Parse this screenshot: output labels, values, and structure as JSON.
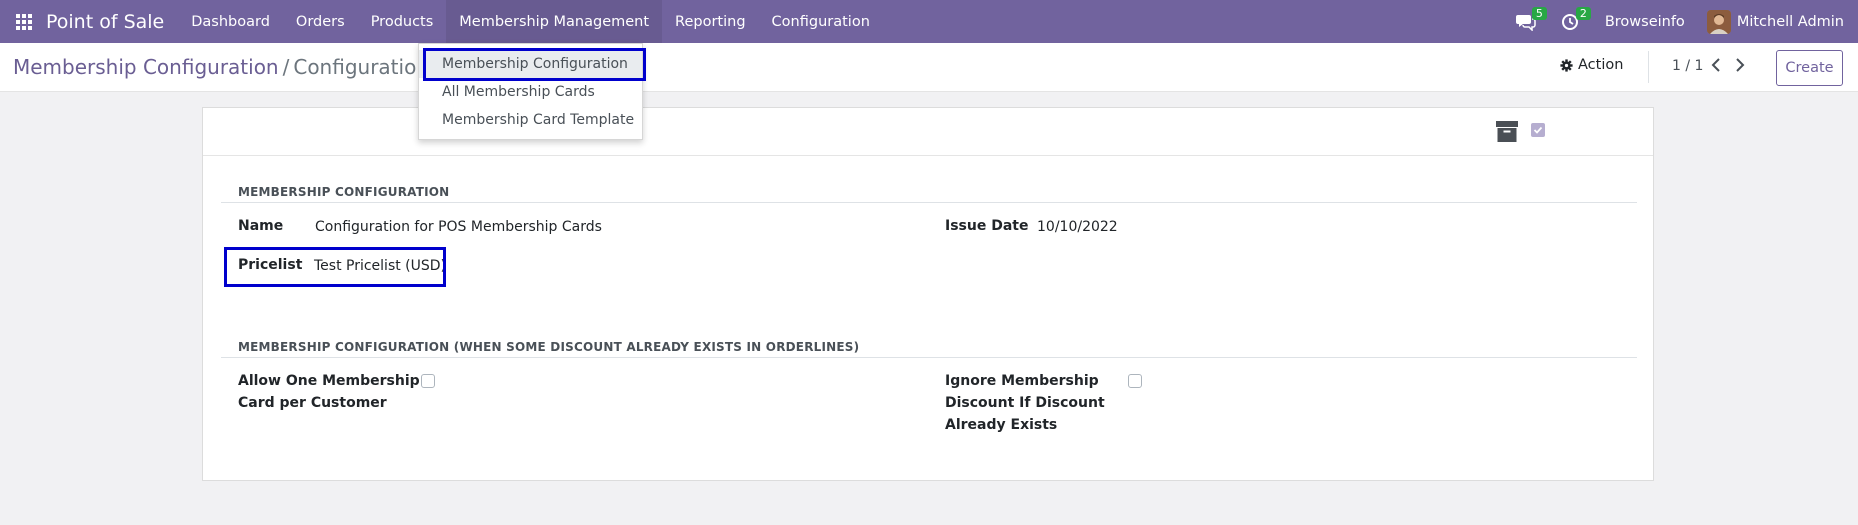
{
  "navbar": {
    "brand": "Point of Sale",
    "menu": [
      "Dashboard",
      "Orders",
      "Products",
      "Membership Management",
      "Reporting",
      "Configuration"
    ],
    "messages_count": "5",
    "activities_count": "2",
    "company": "Browseinfo",
    "user": "Mitchell Admin",
    "colors": {
      "bar": "#71639e",
      "badge": "#28a745"
    }
  },
  "dropdown": {
    "items": [
      "Membership Configuration",
      "All Membership Cards",
      "Membership Card Template"
    ]
  },
  "control_panel": {
    "breadcrumb_parent": "Membership Configuration",
    "breadcrumb_current": "Configuration fo",
    "action_label": "Action",
    "pager": "1 / 1",
    "create_label": "Create"
  },
  "form": {
    "section1_title": "MEMBERSHIP CONFIGURATION",
    "name_label": "Name",
    "name_value": "Configuration for POS Membership Cards",
    "issue_date_label": "Issue Date",
    "issue_date_value": "10/10/2022",
    "pricelist_label": "Pricelist",
    "pricelist_value": "Test Pricelist (USD)",
    "section2_title": "MEMBERSHIP CONFIGURATION (WHEN SOME DISCOUNT ALREADY EXISTS IN ORDERLINES)",
    "allow_one_label_line1": "Allow One Membership",
    "allow_one_label_line2": "Card per Customer",
    "ignore_label_line1": "Ignore Membership",
    "ignore_label_line2": "Discount If Discount",
    "ignore_label_line3": "Already Exists",
    "allow_one_checked": false,
    "ignore_checked": false
  },
  "highlight_color": "#0000cc"
}
